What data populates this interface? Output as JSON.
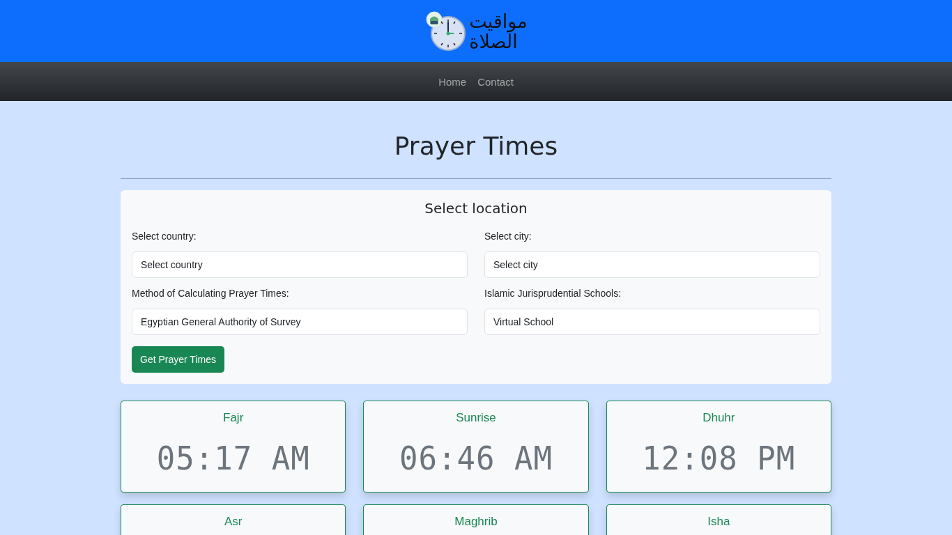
{
  "header": {
    "logo_lines": [
      "مواقيت",
      "الصلاة"
    ]
  },
  "nav": {
    "links": [
      "Home",
      "Contact"
    ]
  },
  "page_title": "Prayer Times",
  "location_form": {
    "title": "Select location",
    "fields": [
      {
        "label": "Select country:",
        "value": "Select country"
      },
      {
        "label": "Select city:",
        "value": "Select city"
      },
      {
        "label": "Method of Calculating Prayer Times:",
        "value": "Egyptian General Authority of Survey"
      },
      {
        "label": "Islamic Jurisprudential Schools:",
        "value": "Virtual School"
      }
    ],
    "button": "Get Prayer Times"
  },
  "prayers": [
    {
      "name": "Fajr",
      "time": "05:17 AM"
    },
    {
      "name": "Sunrise",
      "time": "06:46 AM"
    },
    {
      "name": "Dhuhr",
      "time": "12:08 PM"
    },
    {
      "name": "Asr"
    },
    {
      "name": "Maghrib"
    },
    {
      "name": "Isha"
    }
  ]
}
